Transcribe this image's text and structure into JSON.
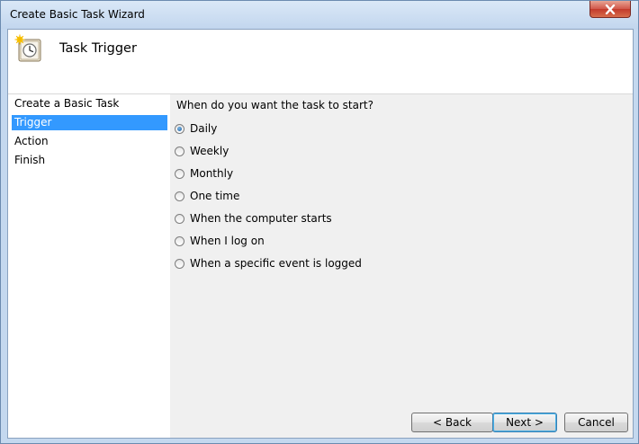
{
  "window": {
    "title": "Create Basic Task Wizard"
  },
  "header": {
    "title": "Task Trigger",
    "icon": "clock-icon"
  },
  "sidebar": {
    "steps": [
      {
        "label": "Create a Basic Task",
        "active": false
      },
      {
        "label": "Trigger",
        "active": true
      },
      {
        "label": "Action",
        "active": false
      },
      {
        "label": "Finish",
        "active": false
      }
    ]
  },
  "main": {
    "question": "When do you want the task to start?",
    "options": [
      {
        "label": "Daily",
        "checked": true
      },
      {
        "label": "Weekly",
        "checked": false
      },
      {
        "label": "Monthly",
        "checked": false
      },
      {
        "label": "One time",
        "checked": false
      },
      {
        "label": "When the computer starts",
        "checked": false
      },
      {
        "label": "When I log on",
        "checked": false
      },
      {
        "label": "When a specific event is logged",
        "checked": false
      }
    ]
  },
  "buttons": {
    "back": "< Back",
    "next": "Next >",
    "cancel": "Cancel"
  },
  "colors": {
    "selection": "#3399ff",
    "close_button": "#c33a2b"
  }
}
